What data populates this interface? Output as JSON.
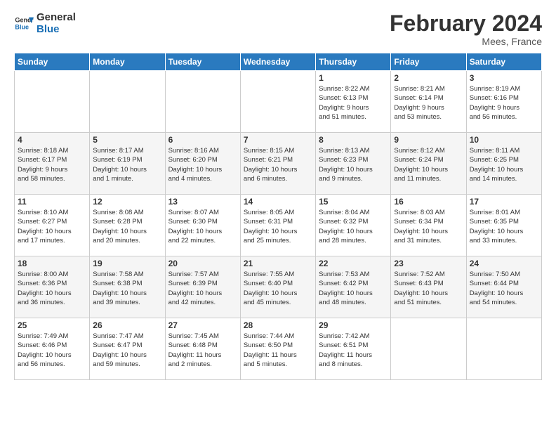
{
  "header": {
    "logo_general": "General",
    "logo_blue": "Blue",
    "month_year": "February 2024",
    "location": "Mees, France"
  },
  "columns": [
    "Sunday",
    "Monday",
    "Tuesday",
    "Wednesday",
    "Thursday",
    "Friday",
    "Saturday"
  ],
  "weeks": [
    [
      {
        "day": "",
        "detail": ""
      },
      {
        "day": "",
        "detail": ""
      },
      {
        "day": "",
        "detail": ""
      },
      {
        "day": "",
        "detail": ""
      },
      {
        "day": "1",
        "detail": "Sunrise: 8:22 AM\nSunset: 6:13 PM\nDaylight: 9 hours\nand 51 minutes."
      },
      {
        "day": "2",
        "detail": "Sunrise: 8:21 AM\nSunset: 6:14 PM\nDaylight: 9 hours\nand 53 minutes."
      },
      {
        "day": "3",
        "detail": "Sunrise: 8:19 AM\nSunset: 6:16 PM\nDaylight: 9 hours\nand 56 minutes."
      }
    ],
    [
      {
        "day": "4",
        "detail": "Sunrise: 8:18 AM\nSunset: 6:17 PM\nDaylight: 9 hours\nand 58 minutes."
      },
      {
        "day": "5",
        "detail": "Sunrise: 8:17 AM\nSunset: 6:19 PM\nDaylight: 10 hours\nand 1 minute."
      },
      {
        "day": "6",
        "detail": "Sunrise: 8:16 AM\nSunset: 6:20 PM\nDaylight: 10 hours\nand 4 minutes."
      },
      {
        "day": "7",
        "detail": "Sunrise: 8:15 AM\nSunset: 6:21 PM\nDaylight: 10 hours\nand 6 minutes."
      },
      {
        "day": "8",
        "detail": "Sunrise: 8:13 AM\nSunset: 6:23 PM\nDaylight: 10 hours\nand 9 minutes."
      },
      {
        "day": "9",
        "detail": "Sunrise: 8:12 AM\nSunset: 6:24 PM\nDaylight: 10 hours\nand 11 minutes."
      },
      {
        "day": "10",
        "detail": "Sunrise: 8:11 AM\nSunset: 6:25 PM\nDaylight: 10 hours\nand 14 minutes."
      }
    ],
    [
      {
        "day": "11",
        "detail": "Sunrise: 8:10 AM\nSunset: 6:27 PM\nDaylight: 10 hours\nand 17 minutes."
      },
      {
        "day": "12",
        "detail": "Sunrise: 8:08 AM\nSunset: 6:28 PM\nDaylight: 10 hours\nand 20 minutes."
      },
      {
        "day": "13",
        "detail": "Sunrise: 8:07 AM\nSunset: 6:30 PM\nDaylight: 10 hours\nand 22 minutes."
      },
      {
        "day": "14",
        "detail": "Sunrise: 8:05 AM\nSunset: 6:31 PM\nDaylight: 10 hours\nand 25 minutes."
      },
      {
        "day": "15",
        "detail": "Sunrise: 8:04 AM\nSunset: 6:32 PM\nDaylight: 10 hours\nand 28 minutes."
      },
      {
        "day": "16",
        "detail": "Sunrise: 8:03 AM\nSunset: 6:34 PM\nDaylight: 10 hours\nand 31 minutes."
      },
      {
        "day": "17",
        "detail": "Sunrise: 8:01 AM\nSunset: 6:35 PM\nDaylight: 10 hours\nand 33 minutes."
      }
    ],
    [
      {
        "day": "18",
        "detail": "Sunrise: 8:00 AM\nSunset: 6:36 PM\nDaylight: 10 hours\nand 36 minutes."
      },
      {
        "day": "19",
        "detail": "Sunrise: 7:58 AM\nSunset: 6:38 PM\nDaylight: 10 hours\nand 39 minutes."
      },
      {
        "day": "20",
        "detail": "Sunrise: 7:57 AM\nSunset: 6:39 PM\nDaylight: 10 hours\nand 42 minutes."
      },
      {
        "day": "21",
        "detail": "Sunrise: 7:55 AM\nSunset: 6:40 PM\nDaylight: 10 hours\nand 45 minutes."
      },
      {
        "day": "22",
        "detail": "Sunrise: 7:53 AM\nSunset: 6:42 PM\nDaylight: 10 hours\nand 48 minutes."
      },
      {
        "day": "23",
        "detail": "Sunrise: 7:52 AM\nSunset: 6:43 PM\nDaylight: 10 hours\nand 51 minutes."
      },
      {
        "day": "24",
        "detail": "Sunrise: 7:50 AM\nSunset: 6:44 PM\nDaylight: 10 hours\nand 54 minutes."
      }
    ],
    [
      {
        "day": "25",
        "detail": "Sunrise: 7:49 AM\nSunset: 6:46 PM\nDaylight: 10 hours\nand 56 minutes."
      },
      {
        "day": "26",
        "detail": "Sunrise: 7:47 AM\nSunset: 6:47 PM\nDaylight: 10 hours\nand 59 minutes."
      },
      {
        "day": "27",
        "detail": "Sunrise: 7:45 AM\nSunset: 6:48 PM\nDaylight: 11 hours\nand 2 minutes."
      },
      {
        "day": "28",
        "detail": "Sunrise: 7:44 AM\nSunset: 6:50 PM\nDaylight: 11 hours\nand 5 minutes."
      },
      {
        "day": "29",
        "detail": "Sunrise: 7:42 AM\nSunset: 6:51 PM\nDaylight: 11 hours\nand 8 minutes."
      },
      {
        "day": "",
        "detail": ""
      },
      {
        "day": "",
        "detail": ""
      }
    ]
  ]
}
